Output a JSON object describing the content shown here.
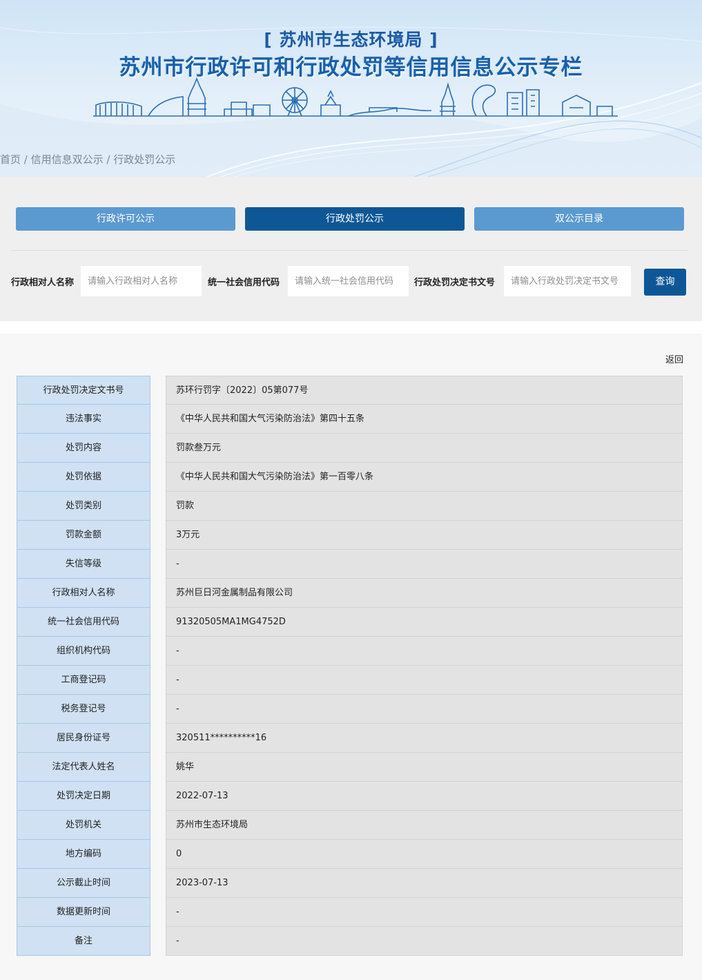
{
  "banner": {
    "agency": "[ 苏州市生态环境局 ]",
    "title": "苏州市行政许可和行政处罚等信用信息公示专栏"
  },
  "breadcrumb": [
    "首页",
    "信用信息双公示",
    "行政处罚公示"
  ],
  "breadcrumb_separator": " / ",
  "tabs": [
    {
      "label": "行政许可公示",
      "active": false
    },
    {
      "label": "行政处罚公示",
      "active": true
    },
    {
      "label": "双公示目录",
      "active": false
    }
  ],
  "search": {
    "name_label": "行政相对人名称",
    "name_placeholder": "请输入行政相对人名称",
    "credit_label": "统一社会信用代码",
    "credit_placeholder": "请输入统一社会信用代码",
    "doc_label": "行政处罚决定书文号",
    "doc_placeholder": "请输入行政处罚决定书文号",
    "button": "查询"
  },
  "back_label": "返回",
  "records": [
    {
      "label": "行政处罚决定文书号",
      "value": "苏环行罚字〔2022〕05第077号"
    },
    {
      "label": "违法事实",
      "value": "《中华人民共和国大气污染防治法》第四十五条"
    },
    {
      "label": "处罚内容",
      "value": "罚款叁万元"
    },
    {
      "label": "处罚依据",
      "value": "《中华人民共和国大气污染防治法》第一百零八条"
    },
    {
      "label": "处罚类别",
      "value": "罚款"
    },
    {
      "label": "罚款金额",
      "value": "3万元"
    },
    {
      "label": "失信等级",
      "value": "-"
    },
    {
      "label": "行政相对人名称",
      "value": "苏州巨日河金属制品有限公司"
    },
    {
      "label": "统一社会信用代码",
      "value": "91320505MA1MG4752D"
    },
    {
      "label": "组织机构代码",
      "value": "-"
    },
    {
      "label": "工商登记码",
      "value": "-"
    },
    {
      "label": "税务登记号",
      "value": "-"
    },
    {
      "label": "居民身份证号",
      "value": "320511**********16"
    },
    {
      "label": "法定代表人姓名",
      "value": "姚华"
    },
    {
      "label": "处罚决定日期",
      "value": "2022-07-13"
    },
    {
      "label": "处罚机关",
      "value": "苏州市生态环境局"
    },
    {
      "label": "地方编码",
      "value": "0"
    },
    {
      "label": "公示截止时间",
      "value": "2023-07-13"
    },
    {
      "label": "数据更新时间",
      "value": "-"
    },
    {
      "label": "备注",
      "value": "-"
    }
  ],
  "colors": {
    "accent": "#0e5796",
    "tab_light": "#5b9ad0",
    "label_bg": "#cfe1f3",
    "value_bg": "#e3e3e3",
    "title_blue": "#1860ac"
  }
}
